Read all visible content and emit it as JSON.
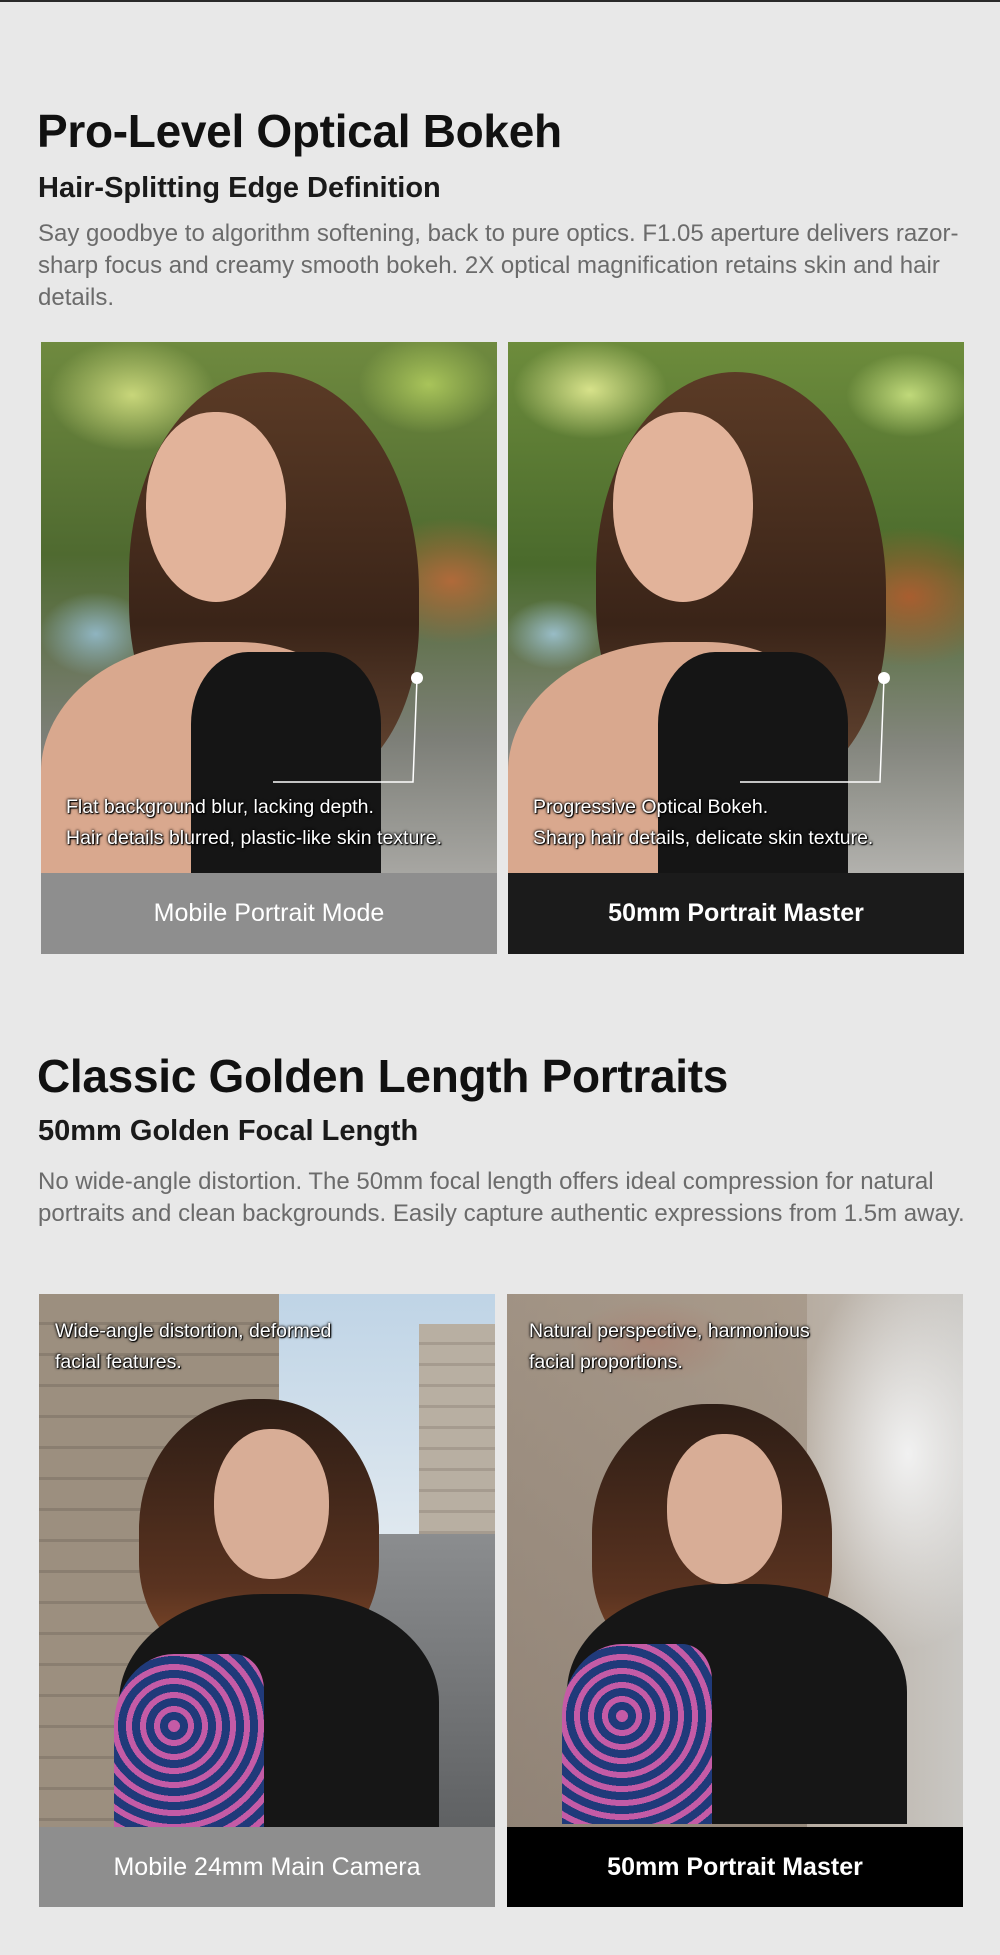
{
  "section1": {
    "title": "Pro-Level Optical Bokeh",
    "subtitle": "Hair-Splitting Edge Definition",
    "description": "Say goodbye to algorithm softening, back to pure optics. F1.05 aperture delivers razor-sharp focus and creamy smooth bokeh. 2X optical magnification retains skin and hair details.",
    "left_card": {
      "caption_line1": "Flat background blur, lacking depth.",
      "caption_line2": "Hair details blurred, plastic-like skin texture.",
      "label": "Mobile Portrait Mode"
    },
    "right_card": {
      "caption_line1": "Progressive Optical Bokeh.",
      "caption_line2": "Sharp hair details, delicate skin texture.",
      "label": "50mm Portrait Master"
    }
  },
  "section2": {
    "title": "Classic Golden Length Portraits",
    "subtitle": "50mm Golden Focal Length",
    "description": "No wide-angle distortion. The 50mm focal length offers ideal compression for natural portraits and clean backgrounds. Easily capture authentic expressions from 1.5m away.",
    "left_card": {
      "caption_line1": "Wide-angle distortion, deformed",
      "caption_line2": "facial features.",
      "label": "Mobile 24mm Main Camera"
    },
    "right_card": {
      "caption_line1": "Natural perspective, harmonious",
      "caption_line2": "facial proportions.",
      "label": "50mm Portrait Master"
    }
  },
  "colors": {
    "page_background": "#e8e8e8",
    "label_gray": "#8e8e8e",
    "label_dark": "#1b1b1b",
    "label_black": "#000000",
    "title_text": "#111111",
    "description_text": "#6b6b6b"
  }
}
